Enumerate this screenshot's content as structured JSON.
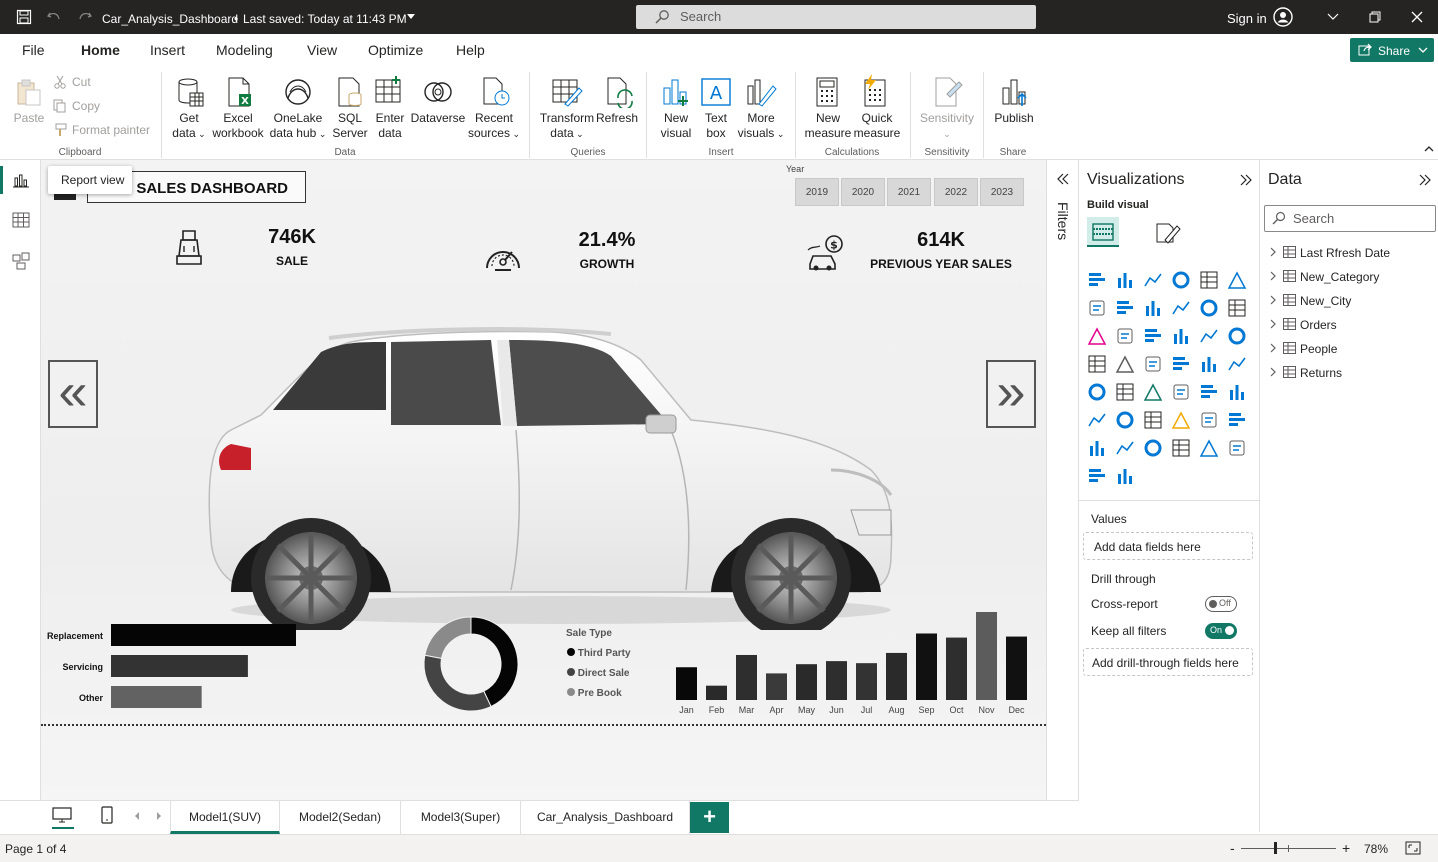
{
  "titlebar": {
    "file_name": "Car_Analysis_Dashboard",
    "saved_text": "Last saved: Today at 11:43 PM",
    "search_placeholder": "Search",
    "sign_in": "Sign in"
  },
  "menu": {
    "items": [
      "File",
      "Home",
      "Insert",
      "Modeling",
      "View",
      "Optimize",
      "Help"
    ],
    "active": "Home",
    "share_label": "Share"
  },
  "ribbon": {
    "clipboard": {
      "paste": "Paste",
      "cut": "Cut",
      "copy": "Copy",
      "format_painter": "Format painter",
      "group": "Clipboard"
    },
    "data": {
      "get_data": [
        "Get",
        "data"
      ],
      "excel": [
        "Excel",
        "workbook"
      ],
      "onelake": [
        "OneLake",
        "data hub"
      ],
      "sql": [
        "SQL",
        "Server"
      ],
      "enter": [
        "Enter",
        "data"
      ],
      "dataverse": "Dataverse",
      "recent": [
        "Recent",
        "sources"
      ],
      "group": "Data"
    },
    "queries": {
      "transform": [
        "Transform",
        "data"
      ],
      "refresh": "Refresh",
      "group": "Queries"
    },
    "insert": {
      "new_visual": [
        "New",
        "visual"
      ],
      "text_box": [
        "Text",
        "box"
      ],
      "more_visuals": [
        "More",
        "visuals"
      ],
      "group": "Insert"
    },
    "calculations": {
      "new_measure": [
        "New",
        "measure"
      ],
      "quick_measure": [
        "Quick",
        "measure"
      ],
      "group": "Calculations"
    },
    "sensitivity": {
      "label": "Sensitivity",
      "group": "Sensitivity"
    },
    "share": {
      "publish": "Publish",
      "group": "Share"
    }
  },
  "leftrail": {
    "tooltip": "Report view"
  },
  "report": {
    "title": "R SALES DASHBOARD",
    "year_label": "Year",
    "years": [
      "2019",
      "2020",
      "2021",
      "2022",
      "2023"
    ],
    "kpis": [
      {
        "value": "746K",
        "label": "SALE",
        "icon": "car-seat-icon"
      },
      {
        "value": "21.4%",
        "label": "GROWTH",
        "icon": "speedometer-icon"
      },
      {
        "value": "614K",
        "label": "PREVIOUS YEAR SALES",
        "icon": "car-money-icon"
      }
    ],
    "prev_arrow": "«",
    "next_arrow": "»",
    "bar_chart": {
      "categories": [
        "Replacement",
        "Servicing",
        "Other"
      ],
      "values": [
        100,
        74,
        49
      ],
      "colors": [
        "#050505",
        "#333333",
        "#626262"
      ]
    },
    "donut": {
      "title": "Sale Type",
      "legend": [
        "Third Party",
        "Direct Sale",
        "Pre Book"
      ],
      "values": [
        43,
        35,
        22
      ],
      "colors": [
        "#050505",
        "#444444",
        "#8a8a8a"
      ]
    },
    "column_chart": {
      "months": [
        "Jan",
        "Feb",
        "Mar",
        "Apr",
        "May",
        "Jun",
        "Jul",
        "Aug",
        "Sep",
        "Oct",
        "Nov",
        "Dec"
      ],
      "values": [
        32,
        14,
        44,
        26,
        35,
        38,
        36,
        46,
        65,
        61,
        86,
        62
      ],
      "colors": [
        "#080808",
        "#2a2a2a",
        "#2e2e2e",
        "#3a3a3a",
        "#2a2a2a",
        "#2e2e2e",
        "#333333",
        "#2a2a2a",
        "#111111",
        "#2e2e2e",
        "#5c5c5c",
        "#111111"
      ]
    }
  },
  "filters": {
    "label": "Filters"
  },
  "visualizations": {
    "title": "Visualizations",
    "build_visual": "Build visual",
    "values_label": "Values",
    "values_drop": "Add data fields here",
    "drill_through": "Drill through",
    "cross_report": "Cross-report",
    "cross_report_state": "Off",
    "keep_filters": "Keep all filters",
    "keep_filters_state": "On",
    "drill_drop": "Add drill-through fields here",
    "icons": [
      "stacked-bar-icon",
      "stacked-column-icon",
      "clustered-bar-icon",
      "clustered-column-icon",
      "100-bar-icon",
      "100-column-icon",
      "line-chart-icon",
      "area-chart-icon",
      "stacked-area-icon",
      "line-column-icon",
      "line-clustered-column-icon",
      "ribbon-chart-icon",
      "waterfall-icon",
      "funnel-icon",
      "scatter-icon",
      "pie-chart-icon",
      "donut-chart-icon",
      "treemap-icon",
      "map-icon",
      "filled-map-icon",
      "azure-map-icon",
      "gauge-icon",
      "card-icon",
      "multirow-card-icon",
      "kpi-icon",
      "slicer-icon",
      "table-icon",
      "matrix-icon",
      "r-visual-icon",
      "python-visual-icon",
      "key-influencers-icon",
      "decomposition-tree-icon",
      "qa-icon",
      "smart-narrative-icon",
      "goals-icon",
      "paginated-report-icon",
      "power-apps-icon",
      "power-automate-icon",
      "arcgis-map-icon",
      "diamond-visual-icon",
      "chevron-visual-icon",
      "more-visuals-icon",
      "analytics-search-icon",
      "custom-visual-icon"
    ]
  },
  "data_pane": {
    "title": "Data",
    "search_placeholder": "Search",
    "tables": [
      "Last Rfresh Date",
      "New_Category",
      "New_City",
      "Orders",
      "People",
      "Returns"
    ]
  },
  "tabs": {
    "pages": [
      "Model1(SUV)",
      "Model2(Sedan)",
      "Model3(Super)",
      "Car_Analysis_Dashboard"
    ],
    "active": 0,
    "add": "+"
  },
  "status": {
    "page": "Page 1 of 4",
    "zoom": "78%",
    "minus": "-",
    "plus": "+"
  }
}
